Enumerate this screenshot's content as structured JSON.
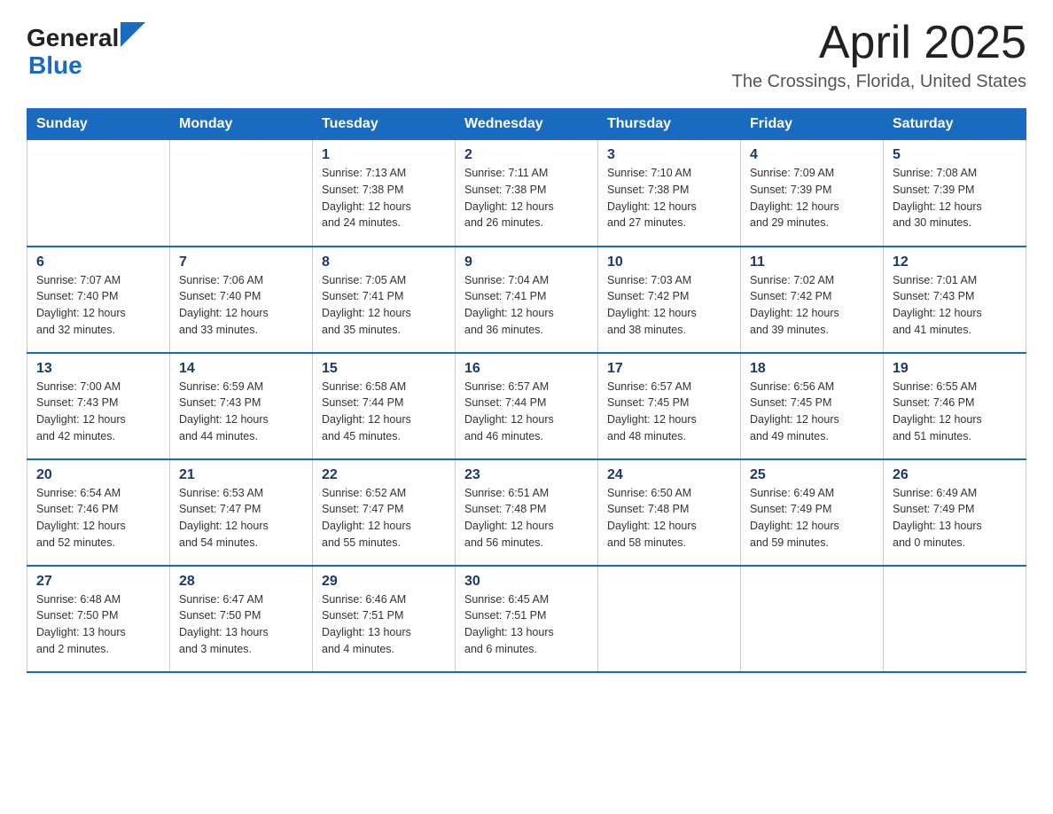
{
  "header": {
    "logo_general": "General",
    "logo_blue": "Blue",
    "title": "April 2025",
    "subtitle": "The Crossings, Florida, United States"
  },
  "weekdays": [
    "Sunday",
    "Monday",
    "Tuesday",
    "Wednesday",
    "Thursday",
    "Friday",
    "Saturday"
  ],
  "weeks": [
    [
      {
        "day": "",
        "info": ""
      },
      {
        "day": "",
        "info": ""
      },
      {
        "day": "1",
        "info": "Sunrise: 7:13 AM\nSunset: 7:38 PM\nDaylight: 12 hours\nand 24 minutes."
      },
      {
        "day": "2",
        "info": "Sunrise: 7:11 AM\nSunset: 7:38 PM\nDaylight: 12 hours\nand 26 minutes."
      },
      {
        "day": "3",
        "info": "Sunrise: 7:10 AM\nSunset: 7:38 PM\nDaylight: 12 hours\nand 27 minutes."
      },
      {
        "day": "4",
        "info": "Sunrise: 7:09 AM\nSunset: 7:39 PM\nDaylight: 12 hours\nand 29 minutes."
      },
      {
        "day": "5",
        "info": "Sunrise: 7:08 AM\nSunset: 7:39 PM\nDaylight: 12 hours\nand 30 minutes."
      }
    ],
    [
      {
        "day": "6",
        "info": "Sunrise: 7:07 AM\nSunset: 7:40 PM\nDaylight: 12 hours\nand 32 minutes."
      },
      {
        "day": "7",
        "info": "Sunrise: 7:06 AM\nSunset: 7:40 PM\nDaylight: 12 hours\nand 33 minutes."
      },
      {
        "day": "8",
        "info": "Sunrise: 7:05 AM\nSunset: 7:41 PM\nDaylight: 12 hours\nand 35 minutes."
      },
      {
        "day": "9",
        "info": "Sunrise: 7:04 AM\nSunset: 7:41 PM\nDaylight: 12 hours\nand 36 minutes."
      },
      {
        "day": "10",
        "info": "Sunrise: 7:03 AM\nSunset: 7:42 PM\nDaylight: 12 hours\nand 38 minutes."
      },
      {
        "day": "11",
        "info": "Sunrise: 7:02 AM\nSunset: 7:42 PM\nDaylight: 12 hours\nand 39 minutes."
      },
      {
        "day": "12",
        "info": "Sunrise: 7:01 AM\nSunset: 7:43 PM\nDaylight: 12 hours\nand 41 minutes."
      }
    ],
    [
      {
        "day": "13",
        "info": "Sunrise: 7:00 AM\nSunset: 7:43 PM\nDaylight: 12 hours\nand 42 minutes."
      },
      {
        "day": "14",
        "info": "Sunrise: 6:59 AM\nSunset: 7:43 PM\nDaylight: 12 hours\nand 44 minutes."
      },
      {
        "day": "15",
        "info": "Sunrise: 6:58 AM\nSunset: 7:44 PM\nDaylight: 12 hours\nand 45 minutes."
      },
      {
        "day": "16",
        "info": "Sunrise: 6:57 AM\nSunset: 7:44 PM\nDaylight: 12 hours\nand 46 minutes."
      },
      {
        "day": "17",
        "info": "Sunrise: 6:57 AM\nSunset: 7:45 PM\nDaylight: 12 hours\nand 48 minutes."
      },
      {
        "day": "18",
        "info": "Sunrise: 6:56 AM\nSunset: 7:45 PM\nDaylight: 12 hours\nand 49 minutes."
      },
      {
        "day": "19",
        "info": "Sunrise: 6:55 AM\nSunset: 7:46 PM\nDaylight: 12 hours\nand 51 minutes."
      }
    ],
    [
      {
        "day": "20",
        "info": "Sunrise: 6:54 AM\nSunset: 7:46 PM\nDaylight: 12 hours\nand 52 minutes."
      },
      {
        "day": "21",
        "info": "Sunrise: 6:53 AM\nSunset: 7:47 PM\nDaylight: 12 hours\nand 54 minutes."
      },
      {
        "day": "22",
        "info": "Sunrise: 6:52 AM\nSunset: 7:47 PM\nDaylight: 12 hours\nand 55 minutes."
      },
      {
        "day": "23",
        "info": "Sunrise: 6:51 AM\nSunset: 7:48 PM\nDaylight: 12 hours\nand 56 minutes."
      },
      {
        "day": "24",
        "info": "Sunrise: 6:50 AM\nSunset: 7:48 PM\nDaylight: 12 hours\nand 58 minutes."
      },
      {
        "day": "25",
        "info": "Sunrise: 6:49 AM\nSunset: 7:49 PM\nDaylight: 12 hours\nand 59 minutes."
      },
      {
        "day": "26",
        "info": "Sunrise: 6:49 AM\nSunset: 7:49 PM\nDaylight: 13 hours\nand 0 minutes."
      }
    ],
    [
      {
        "day": "27",
        "info": "Sunrise: 6:48 AM\nSunset: 7:50 PM\nDaylight: 13 hours\nand 2 minutes."
      },
      {
        "day": "28",
        "info": "Sunrise: 6:47 AM\nSunset: 7:50 PM\nDaylight: 13 hours\nand 3 minutes."
      },
      {
        "day": "29",
        "info": "Sunrise: 6:46 AM\nSunset: 7:51 PM\nDaylight: 13 hours\nand 4 minutes."
      },
      {
        "day": "30",
        "info": "Sunrise: 6:45 AM\nSunset: 7:51 PM\nDaylight: 13 hours\nand 6 minutes."
      },
      {
        "day": "",
        "info": ""
      },
      {
        "day": "",
        "info": ""
      },
      {
        "day": "",
        "info": ""
      }
    ]
  ]
}
